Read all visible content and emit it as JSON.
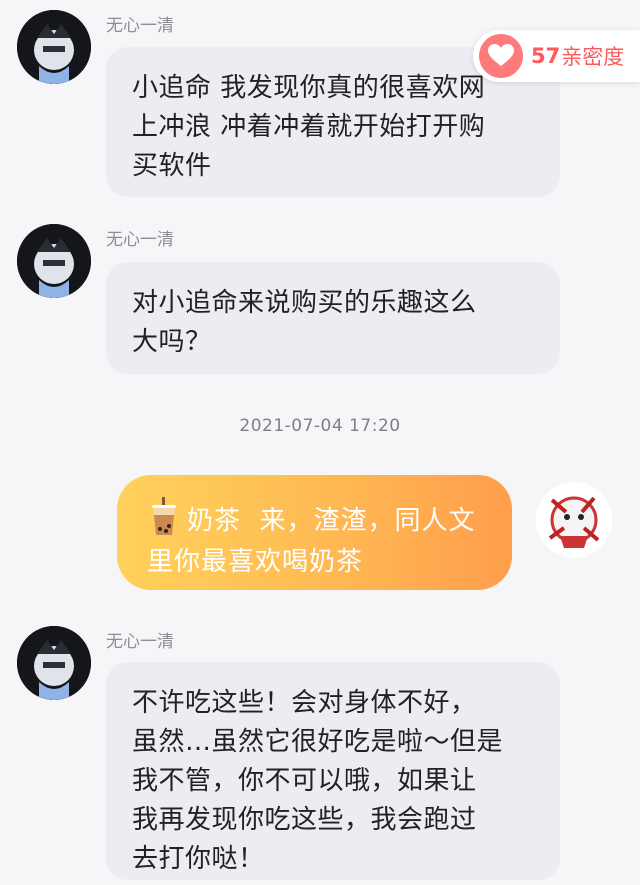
{
  "intimacy": {
    "count": "57",
    "label": "亲密度",
    "icon": "heart-icon"
  },
  "messages": [
    {
      "sender": "无心一清",
      "lines": [
        "小追命 我发现你真的很喜欢网",
        "上冲浪 冲着冲着就开始打开购",
        "买软件"
      ]
    },
    {
      "sender": "无心一清",
      "lines": [
        "对小追命来说购买的乐趣这么",
        "大吗？"
      ]
    },
    {
      "sender": "无心一清",
      "lines": [
        "不许吃这些！会对身体不好，",
        "虽然…虽然它很好吃是啦～但是",
        "我不管，你不可以哦，如果让",
        "我再发现你吃这些，我会跑过",
        "去打你哒！"
      ]
    }
  ],
  "timestamp": "2021-07-04  17:20",
  "my_message": {
    "tag": "奶茶",
    "line1": "来，渣渣，同人文",
    "line2": "里你最喜欢喝奶茶",
    "icon": "milk-tea-icon"
  },
  "colors": {
    "accent": "#ff5a5a",
    "bubble_gradient_start": "#ffd15b",
    "bubble_gradient_end": "#ff9e4c",
    "other_bubble": "#ececf2"
  }
}
